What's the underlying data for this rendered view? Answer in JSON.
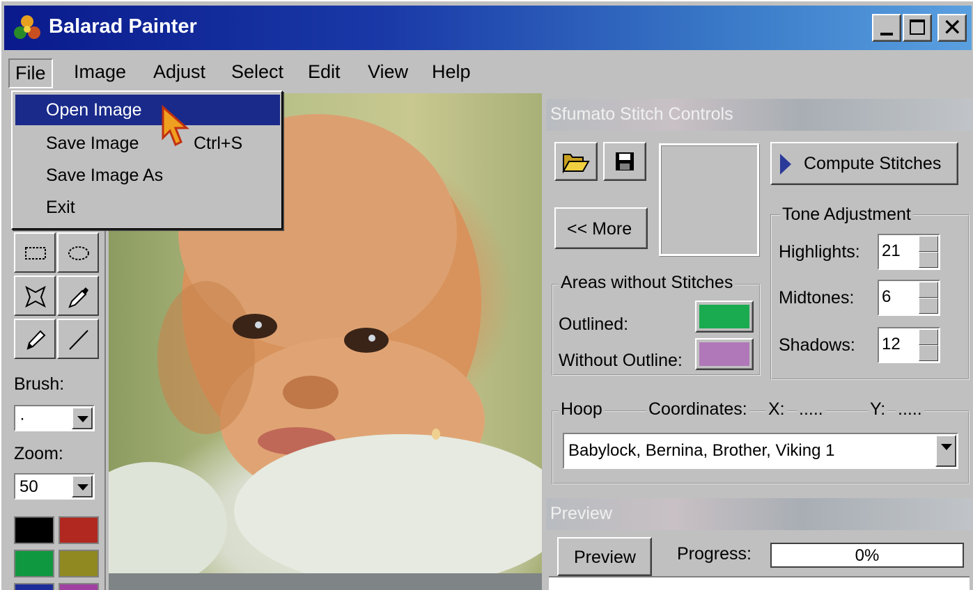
{
  "window": {
    "title": "Balarad Painter"
  },
  "menubar": [
    "File",
    "Image",
    "Adjust",
    "Select",
    "Edit",
    "View",
    "Help"
  ],
  "file_menu": {
    "items": [
      {
        "label": "Open Image",
        "shortcut": ""
      },
      {
        "label": "Save Image",
        "shortcut": "Ctrl+S"
      },
      {
        "label": "Save Image As",
        "shortcut": ""
      },
      {
        "label": "Exit",
        "shortcut": ""
      }
    ],
    "highlighted": "Open Image"
  },
  "toolbox": {
    "brush_label": "Brush:",
    "brush_value": "·",
    "zoom_label": "Zoom:",
    "zoom_value": "50",
    "palette": [
      "#000000",
      "#b02820",
      "#109840",
      "#908820",
      "#1c2c98",
      "#a040a0"
    ]
  },
  "stitch_controls": {
    "header": "Sfumato Stitch Controls",
    "compute_button": "Compute Stitches",
    "more_button": "<< More",
    "areas_group": "Areas without Stitches",
    "outlined_label": "Outlined:",
    "outlined_color": "#1aaa50",
    "without_outline_label": "Without Outline:",
    "without_outline_color": "#b078b8",
    "tone_group": "Tone Adjustment",
    "highlights_label": "Highlights:",
    "highlights_value": "21",
    "midtones_label": "Midtones:",
    "midtones_value": "6",
    "shadows_label": "Shadows:",
    "shadows_value": "12",
    "hoop_label": "Hoop",
    "coordinates_label": "Coordinates:",
    "x_label": "X:",
    "x_value": ".....",
    "y_label": "Y:",
    "y_value": ".....",
    "hoop_value": "Babylock, Bernina, Brother, Viking  1"
  },
  "preview": {
    "header": "Preview",
    "button": "Preview",
    "progress_label": "Progress:",
    "progress_text": "0%",
    "progress_value": 0
  }
}
